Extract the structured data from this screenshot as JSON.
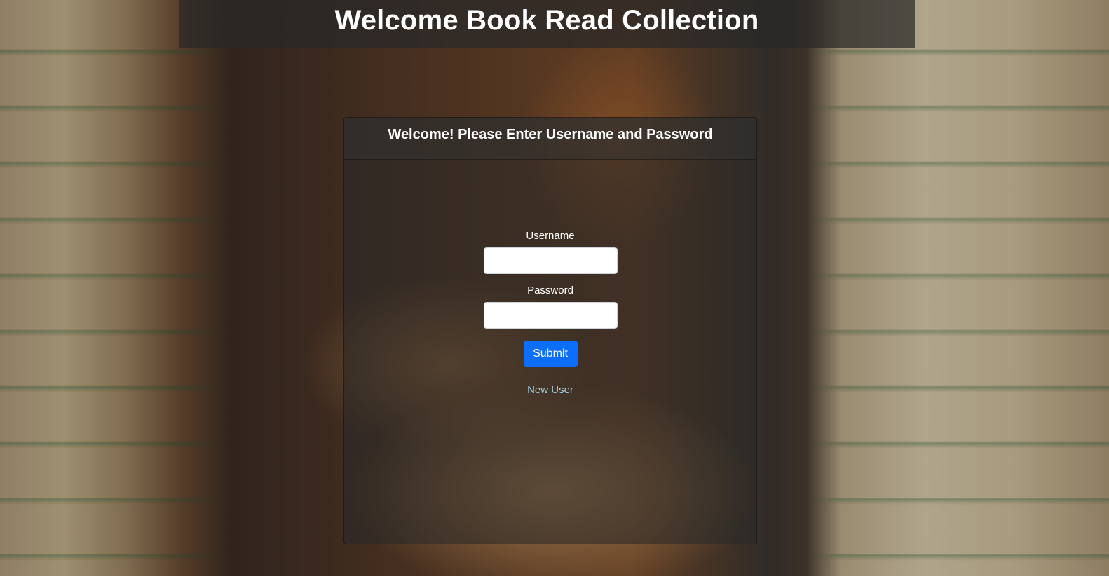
{
  "header": {
    "title": "Welcome Book Read Collection"
  },
  "login_card": {
    "heading": "Welcome! Please Enter Username and Password",
    "username_label": "Username",
    "username_value": "",
    "password_label": "Password",
    "password_value": "",
    "submit_label": "Submit",
    "new_user_link": "New User"
  },
  "colors": {
    "primary_button": "#0d6efd",
    "link": "#9fd3e8"
  }
}
